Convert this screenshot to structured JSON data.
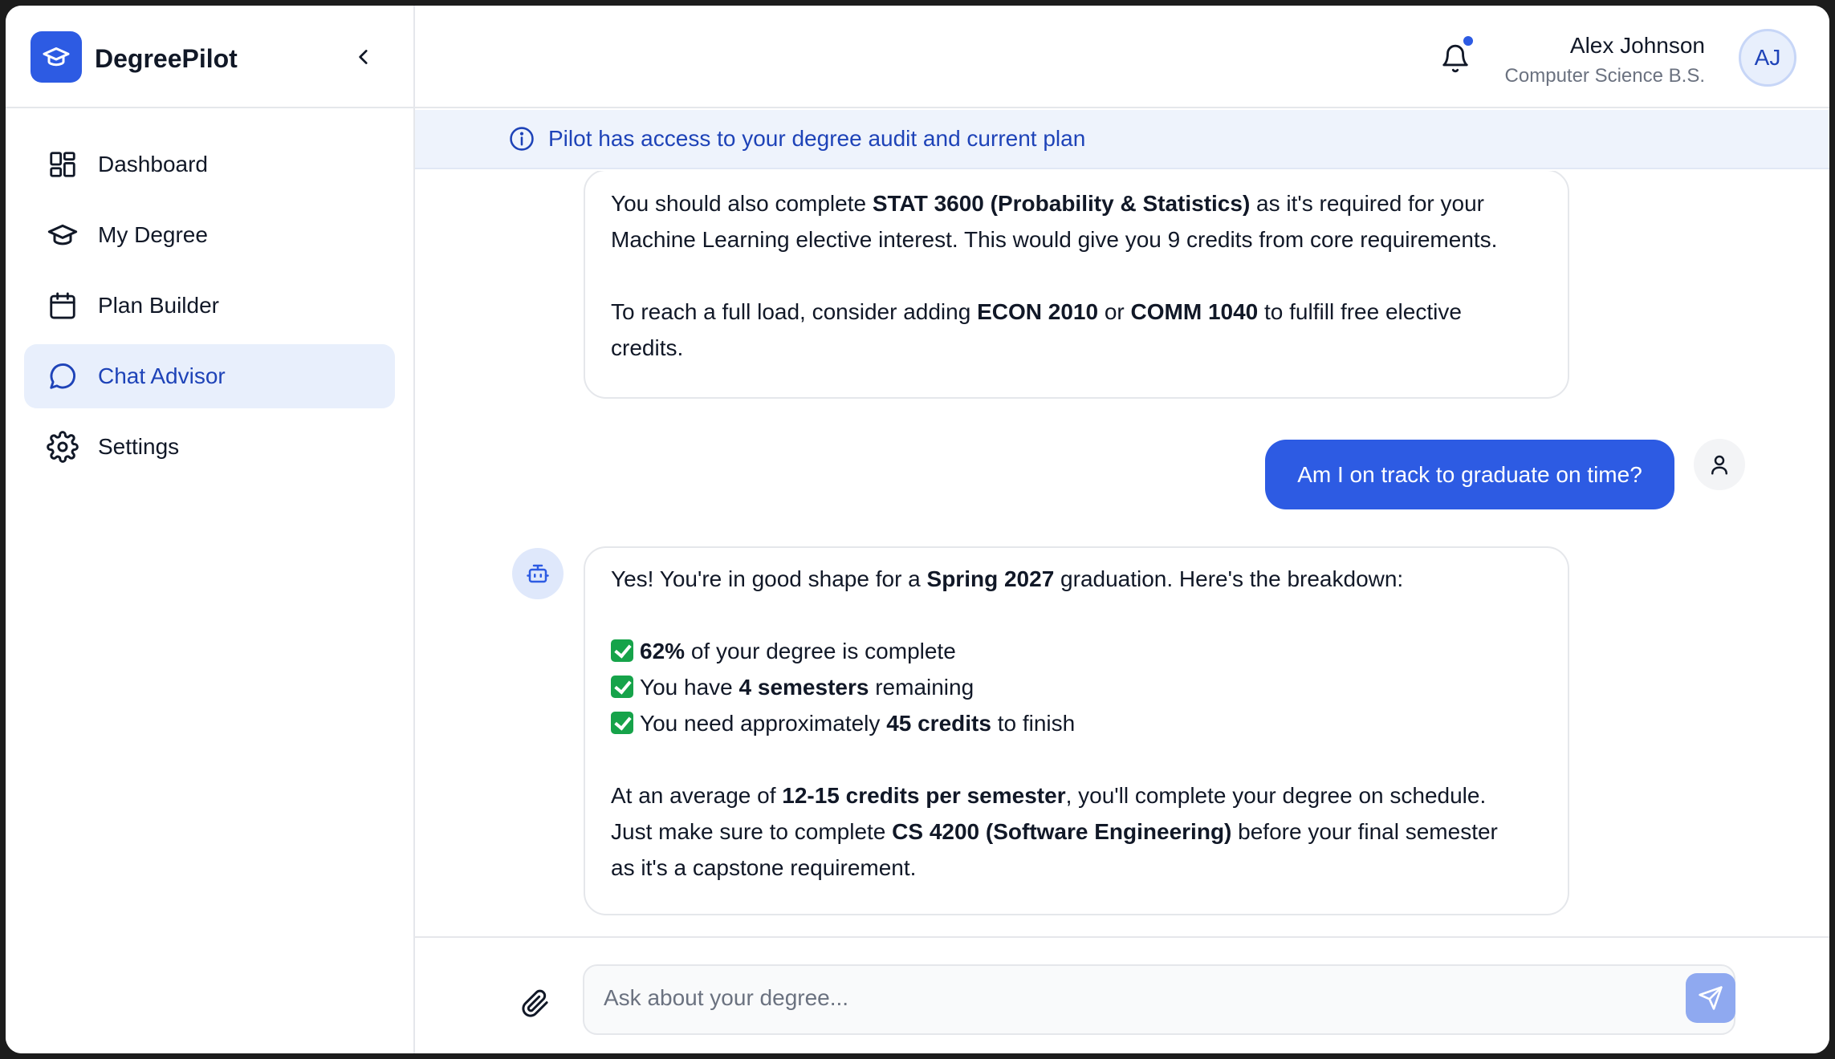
{
  "app": {
    "name": "DegreePilot"
  },
  "sidebar": {
    "items": [
      {
        "label": "Dashboard",
        "icon": "dashboard-icon"
      },
      {
        "label": "My Degree",
        "icon": "graduation-cap-icon"
      },
      {
        "label": "Plan Builder",
        "icon": "calendar-icon"
      },
      {
        "label": "Chat Advisor",
        "icon": "chat-bubble-icon",
        "active": true
      },
      {
        "label": "Settings",
        "icon": "gear-icon"
      }
    ]
  },
  "header": {
    "user_name": "Alex Johnson",
    "user_program": "Computer Science B.S.",
    "avatar_initials": "AJ",
    "has_notification": true
  },
  "banner": {
    "text": "Pilot has access to your degree audit and current plan"
  },
  "messages": {
    "m1": {
      "l1_a": "You should also complete ",
      "l1_b": "STAT 3600 (Probability & Statistics)",
      "l1_c": " as it's required for your",
      "l2": "Machine Learning elective interest. This would give you 9 credits from core requirements.",
      "l3_a": "To reach a full load, consider adding ",
      "l3_b": "ECON 2010",
      "l3_c": " or ",
      "l3_d": "COMM 1040",
      "l3_e": " to fulfill free elective",
      "l4": "credits."
    },
    "user_q": "Am I on track to graduate on time?",
    "m2": {
      "l1_a": "Yes! You're in good shape for a ",
      "l1_b": "Spring 2027",
      "l1_c": " graduation. Here's the breakdown:",
      "c1_b": "62%",
      "c1_c": " of your degree is complete",
      "c2_a": "You have ",
      "c2_b": "4 semesters",
      "c2_c": " remaining",
      "c3_a": "You need approximately ",
      "c3_b": "45 credits",
      "c3_c": " to finish",
      "p1_a": "At an average of ",
      "p1_b": "12-15 credits per semester",
      "p1_c": ", you'll complete your degree on schedule.",
      "p2_a": "Just make sure to complete ",
      "p2_b": "CS 4200 (Software Engineering)",
      "p2_c": " before your final semester",
      "p3": "as it's a capstone requirement."
    }
  },
  "composer": {
    "placeholder": "Ask about your degree...",
    "value": ""
  },
  "colors": {
    "accent": "#2d5be3",
    "accent_light": "#e8effc",
    "accent_text": "#1e43b8",
    "check_green": "#16a34a",
    "send_button": "#8fa9f0"
  }
}
